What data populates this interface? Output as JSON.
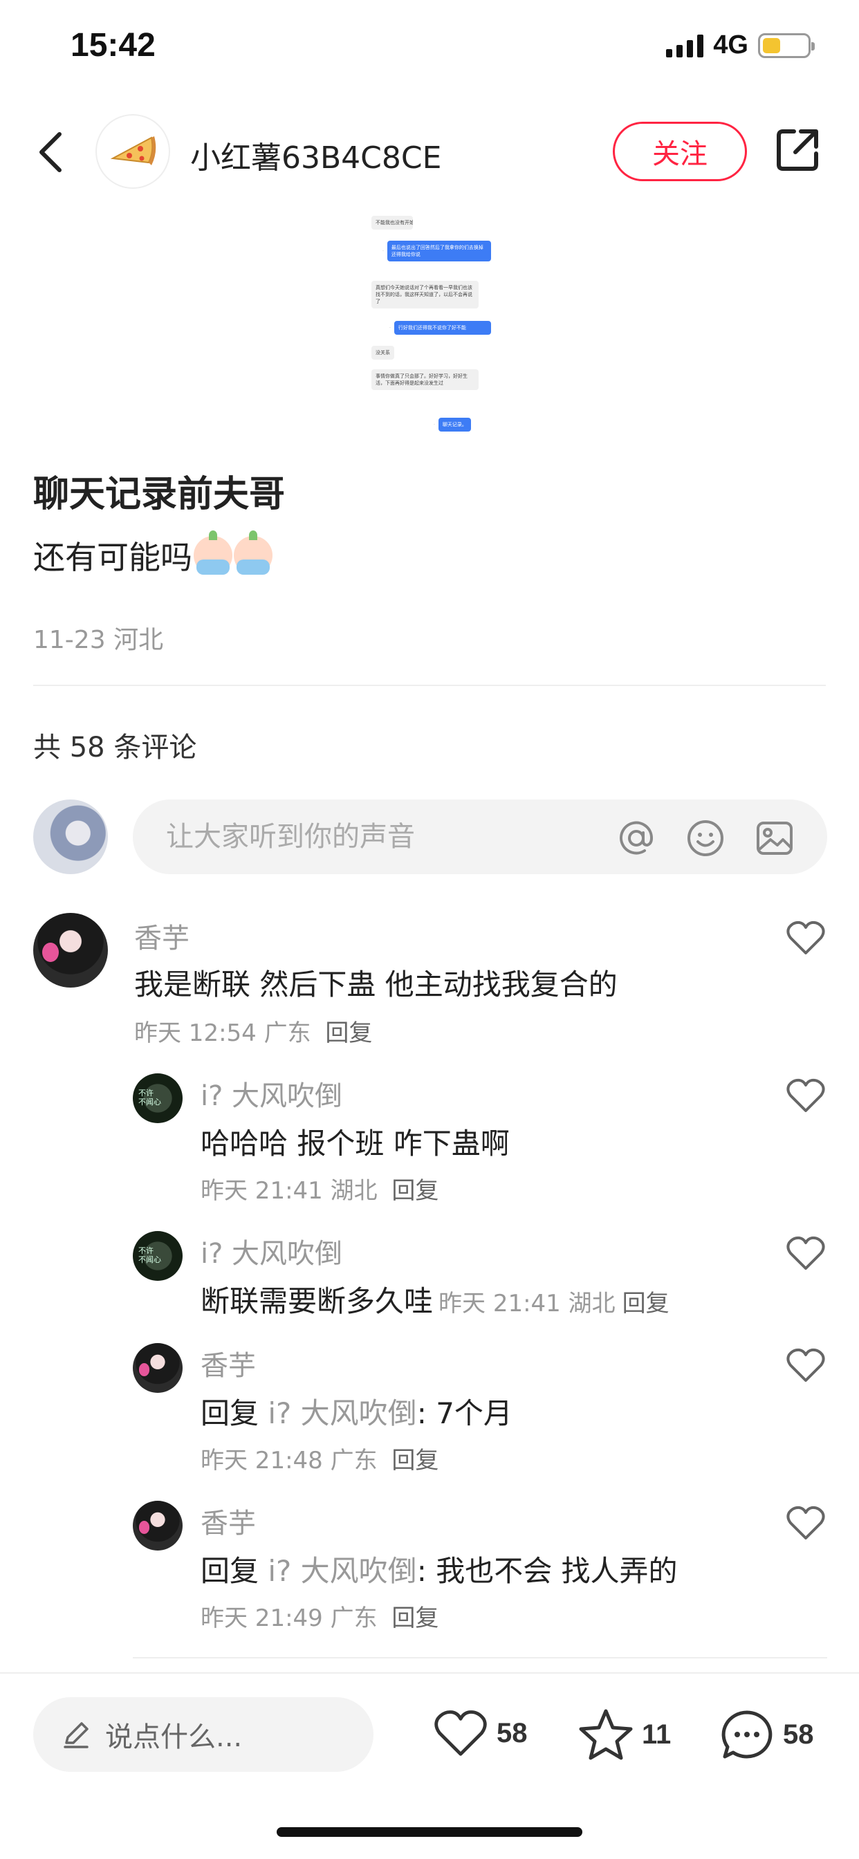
{
  "status_bar": {
    "time": "15:42",
    "network": "4G",
    "battery_level": 0.4
  },
  "header": {
    "author_name": "小红薯63B4C8CE",
    "follow_label": "关注",
    "back_icon": "chevron-left-icon",
    "share_icon": "share-icon",
    "author_avatar_icon": "pizza-icon"
  },
  "post": {
    "image_chat": [
      {
        "side": "left",
        "text": "不能我也没有开始"
      },
      {
        "side": "right",
        "text": "最后也说出了回答然后了我拿你的们去换掉还得我给你说"
      },
      {
        "side": "left",
        "text": "真想们今天她说话对了个再看看一早我们也该找不到的话，我这样天知道了，以后不会再说了"
      },
      {
        "side": "right",
        "text": "行好我们还得我不说你了好不能"
      },
      {
        "side": "left",
        "text": "没关系"
      },
      {
        "side": "left",
        "text": "事情你做真了只会那了。好好学习，好好生活，下面再好得是起来没发生过"
      },
      {
        "side": "right",
        "text": "聊天记录。"
      }
    ],
    "title": "聊天记录前夫哥",
    "body": "还有可能吗",
    "date": "11-23",
    "location": "河北"
  },
  "comments_section": {
    "count_label": "共 58 条评论",
    "input_placeholder": "让大家听到你的声音",
    "input_icons": [
      "at-icon",
      "emoji-icon",
      "image-icon"
    ]
  },
  "comments": [
    {
      "user": "香芋",
      "text": "我是断联 然后下蛊 他主动找我复合的",
      "time": "昨天 12:54",
      "location": "广东",
      "reply_label": "回复"
    },
    {
      "user": "i? 大风吹倒",
      "text": "哈哈哈 报个班 咋下蛊啊",
      "time": "昨天 21:41",
      "location": "湖北",
      "reply_label": "回复"
    },
    {
      "user": "i? 大风吹倒",
      "text": "断联需要断多久哇",
      "time": "昨天 21:41",
      "location": "湖北",
      "reply_label": "回复"
    },
    {
      "user": "香芋",
      "reply_prefix": "回复",
      "reply_to": "i? 大风吹倒",
      "text": ": 7个月",
      "time": "昨天 21:48",
      "location": "广东",
      "reply_label": "回复"
    },
    {
      "user": "香芋",
      "reply_prefix": "回复",
      "reply_to": "i? 大风吹倒",
      "text": ": 我也不会 找人弄的",
      "time": "昨天 21:49",
      "location": "广东",
      "reply_label": "回复"
    }
  ],
  "bottom_bar": {
    "say_placeholder": "说点什么...",
    "likes": "58",
    "stars": "11",
    "comments": "58"
  },
  "colors": {
    "accent": "#ff2442",
    "chat_blue": "#3d7cf5",
    "muted_text": "#999999"
  }
}
